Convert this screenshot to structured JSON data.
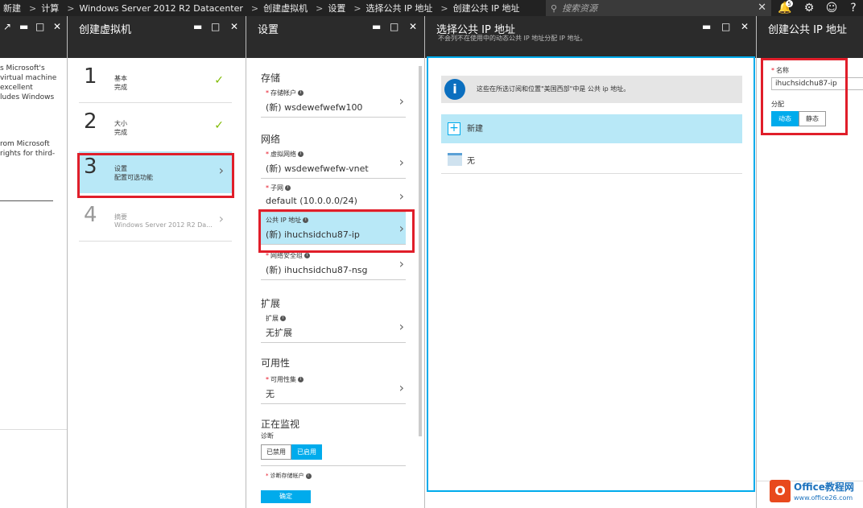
{
  "topbar": {
    "breadcrumbs": [
      "新建",
      "计算",
      "Windows Server 2012 R2 Datacenter",
      "创建虚拟机",
      "设置",
      "选择公共 IP 地址",
      "创建公共 IP 地址"
    ],
    "search_placeholder": "搜索资源",
    "notification_count": "5"
  },
  "blade0": {
    "text_lines": [
      "s Microsoft's",
      "virtual machine",
      "excellent",
      "ludes Windows",
      "rom Microsoft",
      "rights for third-"
    ]
  },
  "blade1": {
    "title": "创建虚拟机",
    "steps": [
      {
        "num": "1",
        "name": "基本",
        "sub": "完成"
      },
      {
        "num": "2",
        "name": "大小",
        "sub": "完成"
      },
      {
        "num": "3",
        "name": "设置",
        "sub": "配置可选功能"
      },
      {
        "num": "4",
        "name": "摘要",
        "sub": "Windows Server 2012 R2 Da..."
      }
    ]
  },
  "blade2": {
    "title": "设置",
    "sections": {
      "storage": "存储",
      "network": "网络",
      "extensions": "扩展",
      "availability": "可用性",
      "monitoring": "正在监视"
    },
    "rows": {
      "storage_account": {
        "label": "存储帐户",
        "value": "(新) wsdewefwefw100"
      },
      "vnet": {
        "label": "虚拟网络",
        "value": "(新) wsdewefwefw-vnet"
      },
      "subnet": {
        "label": "子网",
        "value": "default (10.0.0.0/24)"
      },
      "public_ip": {
        "label": "公共 IP 地址",
        "value": "(新) ihuchsidchu87-ip"
      },
      "nsg": {
        "label": "网络安全组",
        "value": "(新) ihuchsidchu87-nsg"
      },
      "extensions": {
        "label": "扩展",
        "value": "无扩展"
      },
      "availability_set": {
        "label": "可用性集",
        "value": "无"
      },
      "diag_storage": {
        "label": "诊断存储帐户"
      }
    },
    "diagnostics_label": "诊断",
    "diagnostics_options": [
      "已禁用",
      "已启用"
    ],
    "ok_label": "确定"
  },
  "blade3": {
    "title": "选择公共 IP 地址",
    "subtitle": "不会列不在使用中的动态公共 IP 地址分配 IP 地址。",
    "info_text": "这些在所选订阅和位置\"美国西部\"中是 公共 ip 地址。",
    "items": [
      {
        "label": "新建"
      },
      {
        "label": "无"
      }
    ]
  },
  "blade4": {
    "title": "创建公共 IP 地址",
    "name_label": "名称",
    "name_value": "ihuchsidchu87-ip",
    "assignment_label": "分配",
    "assignment_options": [
      "动态",
      "静态"
    ]
  },
  "watermark": {
    "brand": "Office教程网",
    "url": "www.office26.com"
  },
  "colors": {
    "accent": "#00abec",
    "highlight_row": "#b8e8f7",
    "red_box": "#e01e2a",
    "check": "#7fba00"
  }
}
